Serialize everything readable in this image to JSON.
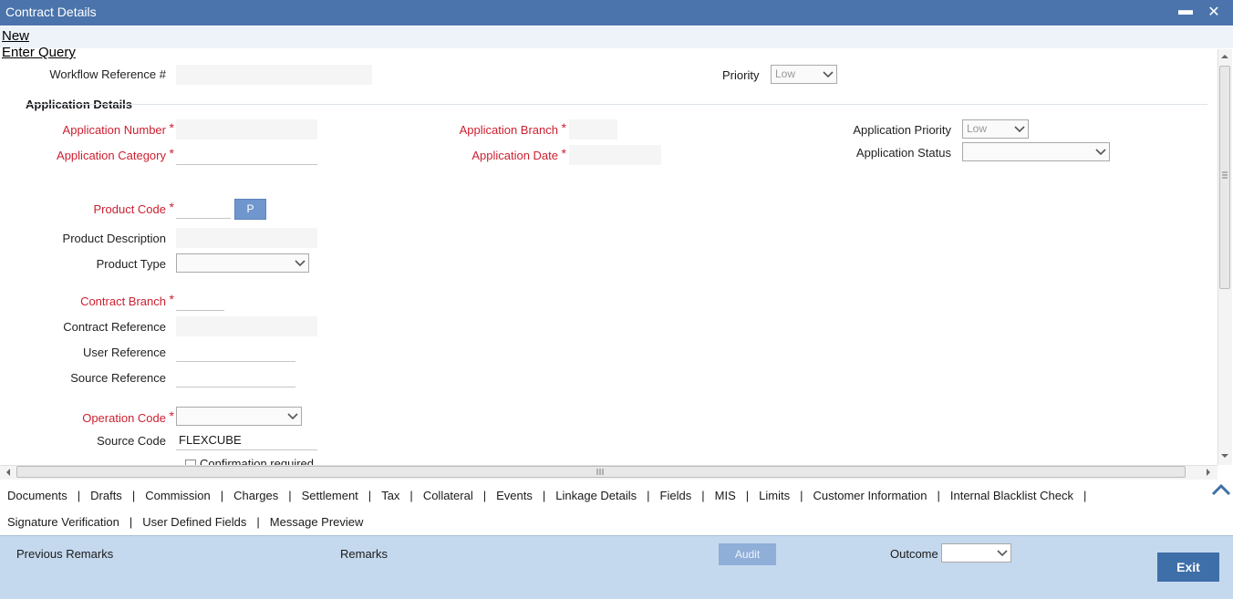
{
  "window": {
    "title": "Contract Details",
    "minimize": "▬",
    "close": "✕"
  },
  "menu": {
    "new": "New",
    "enter_query": "Enter Query"
  },
  "header_fields": {
    "workflow_ref_label": "Workflow Reference #",
    "workflow_ref_value": "",
    "priority_label": "Priority",
    "priority_value": "Low"
  },
  "application": {
    "section_title": "Application Details",
    "number_label": "Application Number",
    "category_label": "Application Category",
    "branch_label": "Application Branch",
    "date_label": "Application Date",
    "priority_label": "Application Priority",
    "priority_value": "Low",
    "status_label": "Application Status",
    "status_value": ""
  },
  "product": {
    "code_label": "Product Code",
    "p_button": "P",
    "description_label": "Product Description",
    "type_label": "Product Type",
    "type_value": ""
  },
  "contract": {
    "branch_label": "Contract Branch",
    "reference_label": "Contract Reference",
    "user_ref_label": "User Reference",
    "source_ref_label": "Source Reference",
    "operation_code_label": "Operation Code",
    "operation_code_value": "",
    "source_code_label": "Source Code",
    "source_code_value": "FLEXCUBE",
    "confirmation_label": "Confirmation required"
  },
  "tabs_row1": [
    "Documents",
    "Drafts",
    "Commission",
    "Charges",
    "Settlement",
    "Tax",
    "Collateral",
    "Events",
    "Linkage Details",
    "Fields",
    "MIS",
    "Limits",
    "Customer Information",
    "Internal Blacklist Check"
  ],
  "tabs_row2": [
    "Signature Verification",
    "User Defined Fields",
    "Message Preview"
  ],
  "footer": {
    "previous_remarks": "Previous Remarks",
    "remarks": "Remarks",
    "audit": "Audit",
    "outcome_label": "Outcome",
    "outcome_value": "",
    "exit": "Exit"
  },
  "icons": {
    "dropdown": "chevron-down-icon",
    "collapse": "chevron-up-icon",
    "scroll_up": "arrow-up-icon",
    "scroll_down": "arrow-down-icon",
    "scroll_left": "arrow-left-icon",
    "scroll_right": "arrow-right-icon"
  },
  "colors": {
    "titlebar": "#4a74ab",
    "required_label": "#cc2030",
    "footer": "#c5d9ee",
    "exit_button": "#3f6fa8"
  }
}
